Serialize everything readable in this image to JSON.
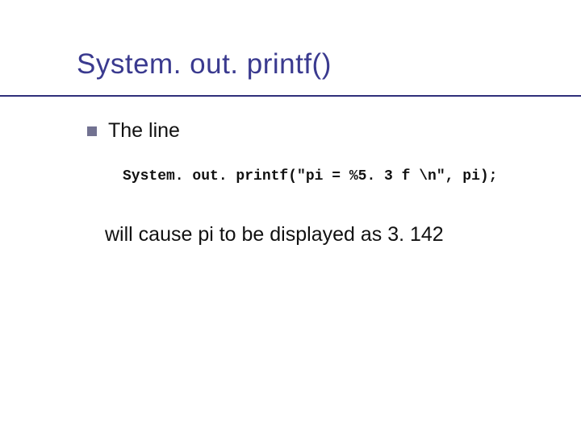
{
  "title": "System. out. printf()",
  "bullet1": "The line",
  "code": "System. out. printf(\"pi = %5. 3 f \\n\", pi);",
  "result": "will cause pi to be displayed as 3. 142"
}
